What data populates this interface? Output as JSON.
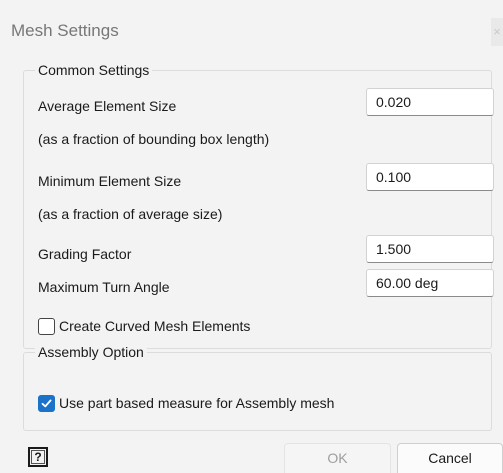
{
  "window": {
    "title": "Mesh Settings",
    "close_glyph": "×"
  },
  "common": {
    "group_label": "Common Settings",
    "avg_size_label": "Average Element Size",
    "avg_size_value": "0.020",
    "avg_size_note": "(as a fraction of bounding box length)",
    "min_size_label": "Minimum Element Size",
    "min_size_value": "0.100",
    "min_size_note": "(as a fraction of average size)",
    "grading_label": "Grading Factor",
    "grading_value": "1.500",
    "turn_angle_label": "Maximum Turn Angle",
    "turn_angle_value": "60.00 deg",
    "curved_label": "Create Curved Mesh Elements",
    "curved_checked": false
  },
  "assembly": {
    "group_label": "Assembly Option",
    "part_based_label": "Use part based measure for Assembly mesh",
    "part_based_checked": true
  },
  "footer": {
    "help_icon": "help-icon",
    "help_glyph": "?",
    "ok_label": "OK",
    "ok_enabled": false,
    "cancel_label": "Cancel"
  },
  "colors": {
    "accent": "#1a73c8",
    "dialog_bg": "#f3f3f3",
    "disabled_text": "#9e9e9e"
  }
}
